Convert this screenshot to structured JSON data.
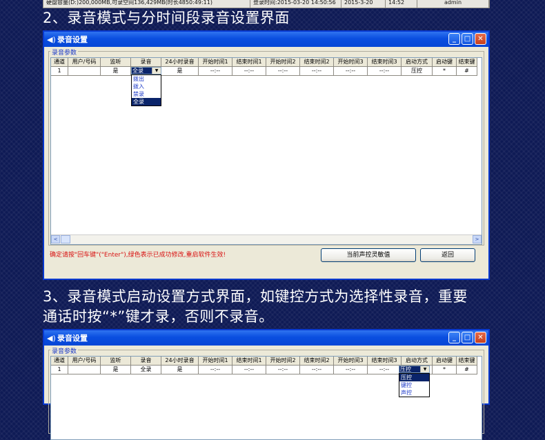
{
  "top_strip": [
    "硬盘容量(D:)200,000MB,可录空间136,429MB(时长4850:49:11)",
    "登录时间:2015-03-20 14:50:56",
    "2015-3-20",
    "14:52",
    "admin"
  ],
  "section2": {
    "heading": "2、录音模式与分时间段录音设置界面"
  },
  "section3": {
    "heading": "3、录音模式启动设置方式界面，如键控方式为选择性录音，重要",
    "heading_line2": "通话时按“*”键才录，否则不录音。"
  },
  "window": {
    "title": "录音设置",
    "group_label": "录音参数",
    "title_icon": "speaker-icon"
  },
  "columns": [
    "通道",
    "用户/号码",
    "监听",
    "录音",
    "24小时录音",
    "开始时间1",
    "结束时间1",
    "开始时间2",
    "结束时间2",
    "开始时间3",
    "结束时间3",
    "启动方式",
    "启动键",
    "结束键"
  ],
  "row1": [
    "1",
    "",
    "是",
    "全录",
    "是",
    "--:--",
    "--:--",
    "--:--",
    "--:--",
    "--:--",
    "--:--",
    "压控",
    "*",
    "#"
  ],
  "record_dropdown": {
    "current": "全录",
    "options": [
      "拨出",
      "拨入",
      "禁录",
      "全录"
    ],
    "selected": "全录"
  },
  "start_dropdown": {
    "current": "压控",
    "options": [
      "压控",
      "键控",
      "声控"
    ],
    "selected": "压控"
  },
  "footer_note": "确定请按\"回车键\"(\"Enter\"),绿色表示已成功修改,重启软件生效!",
  "buttons": {
    "sensitivity": "当前声控灵敏值",
    "back": "返回"
  },
  "titlebar_buttons": {
    "minimize": "_",
    "maximize": "□",
    "close": "✕"
  },
  "scroll": {
    "left": "<",
    "right": ">"
  },
  "colors": {
    "background": "#0e1a55",
    "titlebar": "#0a4ee0",
    "note": "#d81010",
    "highlight": "#0a246a"
  }
}
